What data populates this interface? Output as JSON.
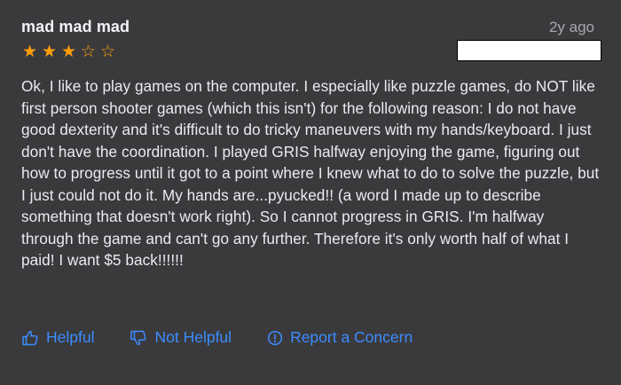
{
  "review": {
    "title": "mad mad mad",
    "time_ago": "2y ago",
    "rating": 3,
    "rating_max": 5,
    "body": "Ok, I like to play games on the computer. I especially like puzzle games, do NOT like first person shooter games (which this isn't) for the following reason: I do not have good dexterity and it's difficult to do tricky maneuvers with my hands/keyboard. I just don't have the coordination. I played GRIS halfway enjoying the game, figuring out how to progress until it got to a point where I knew what to do to solve the puzzle, but I just could not do it. My hands are...pyucked!! (a word I made up to describe something that doesn't work right). So I cannot progress in GRIS. I'm halfway through the game and can't go any further. Therefore it's only worth half of what I paid! I want $5 back!!!!!!"
  },
  "actions": {
    "helpful": "Helpful",
    "not_helpful": "Not Helpful",
    "report": "Report a Concern"
  },
  "icons": {
    "helpful": "thumbs-up-icon",
    "not_helpful": "thumbs-down-icon",
    "report": "exclamation-circle-icon",
    "star_filled": "★",
    "star_empty": "☆"
  },
  "colors": {
    "background": "#3a3a3c",
    "star": "#ff9f0a",
    "link": "#3c8cff",
    "secondary_text": "#a7a7ad"
  }
}
